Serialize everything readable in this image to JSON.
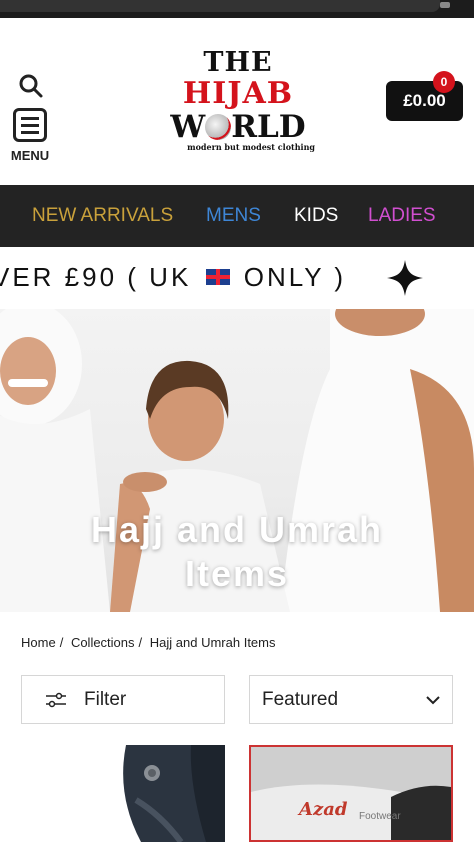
{
  "header": {
    "menu_label": "MENU",
    "logo": {
      "line1": "THE",
      "line2": "HIJAB",
      "line3_left": "W",
      "line3_right": "RLD",
      "tagline": "modern but modest clothing"
    },
    "cart_total": "£0.00",
    "cart_count": "0"
  },
  "nav": {
    "items": [
      {
        "label": "NEW ARRIVALS",
        "color": "#c9a13b"
      },
      {
        "label": "MENS",
        "color": "#3e86d6"
      },
      {
        "label": "KIDS",
        "color": "#ffffff"
      },
      {
        "label": "LADIES",
        "color": "#d14fd0"
      }
    ]
  },
  "announcement": {
    "text_before_flag": "VER £90 ( UK",
    "text_after_flag": "ONLY )"
  },
  "hero": {
    "title_line1": "Hajj and Umrah",
    "title_line2": "Items"
  },
  "breadcrumb": {
    "items": [
      "Home",
      "Collections",
      "Hajj and Umrah Items"
    ],
    "separator": "/"
  },
  "toolbar": {
    "filter_label": "Filter",
    "sort_label": "Featured"
  },
  "products": {
    "card2_brand": "Azad",
    "card2_sub": "Footwear"
  },
  "colors": {
    "brand_red": "#d4131c",
    "nav_bg": "#232323",
    "cart_bg": "#111111"
  }
}
